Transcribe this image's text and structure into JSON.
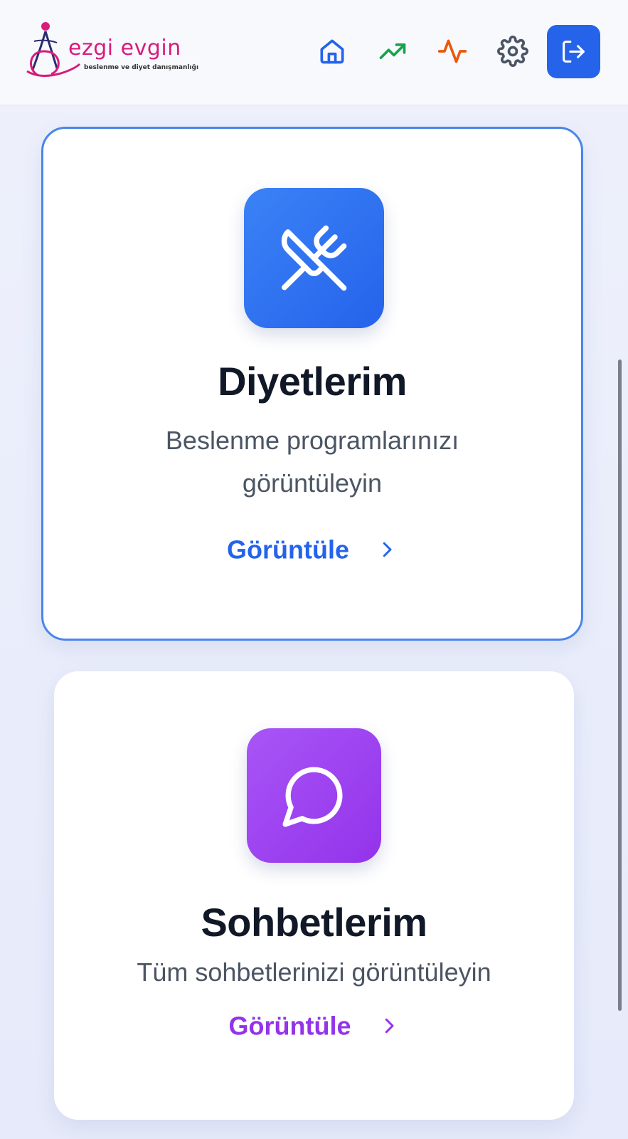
{
  "header": {
    "logo": {
      "name": "ezgi evgin",
      "tagline": "beslenme ve diyet danışmanlığı"
    },
    "nav": [
      {
        "icon": "home-icon",
        "color": "#2563eb"
      },
      {
        "icon": "trending-up-icon",
        "color": "#16a34a"
      },
      {
        "icon": "activity-icon",
        "color": "#ea580c"
      },
      {
        "icon": "settings-icon",
        "color": "#4b5563"
      }
    ],
    "logout": {
      "icon": "logout-icon",
      "color": "#2563eb"
    }
  },
  "cards": [
    {
      "icon": "utensils-crossed-icon",
      "color": "#2563eb",
      "title": "Diyetlerim",
      "description_line1": "Beslenme programlarınızı",
      "description_line2": "görüntüleyin",
      "link_label": "Görüntüle",
      "selected": true
    },
    {
      "icon": "message-circle-icon",
      "color": "#9333ea",
      "title": "Sohbetlerim",
      "description": "Tüm sohbetlerinizi görüntüleyin",
      "link_label": "Görüntüle",
      "selected": false
    }
  ]
}
